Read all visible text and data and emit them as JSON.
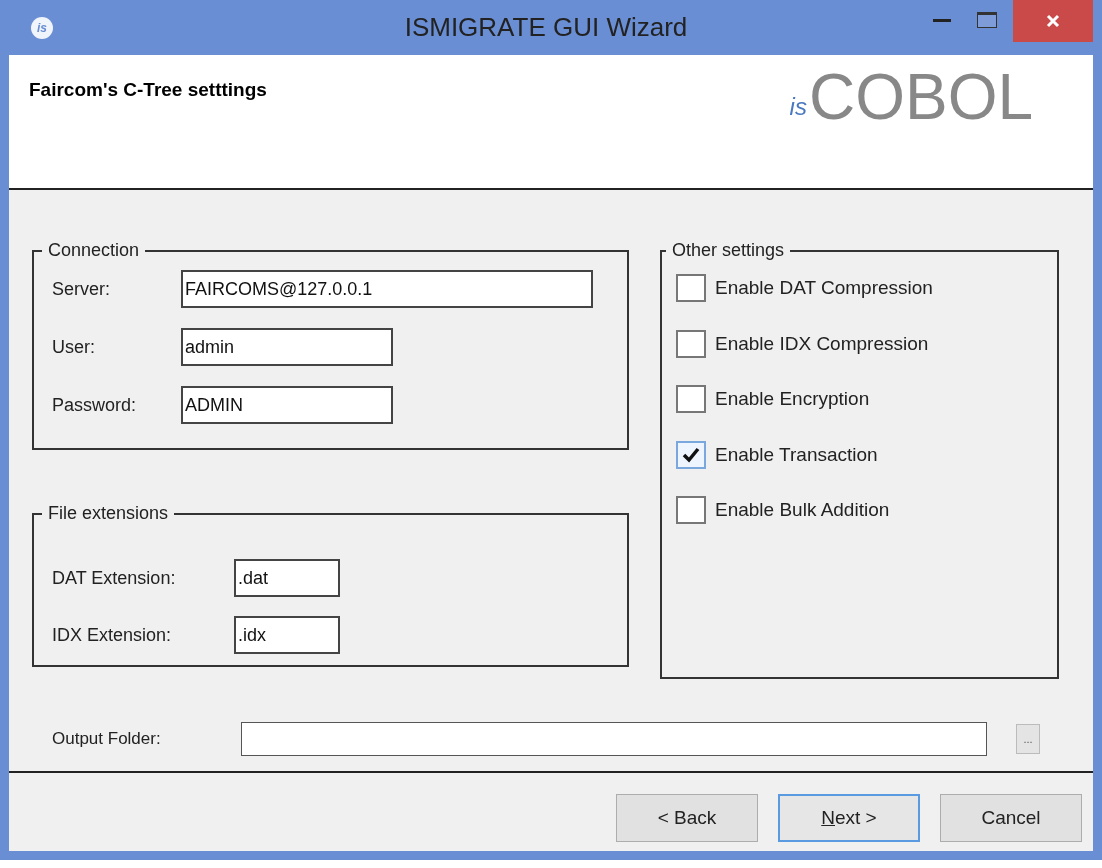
{
  "window": {
    "title": "ISMIGRATE GUI Wizard",
    "app_mark": "is"
  },
  "header": {
    "title": "Faircom's C-Tree setttings",
    "logo_mark": "is",
    "logo_text": "COBOL"
  },
  "connection": {
    "legend": "Connection",
    "fields": [
      {
        "label": "Server:",
        "value": "FAIRCOMS@127.0.0.1",
        "kind": "wide"
      },
      {
        "label": "User:",
        "value": "admin",
        "kind": "short"
      },
      {
        "label": "Password:",
        "value": "ADMIN",
        "kind": "short"
      }
    ]
  },
  "file_extensions": {
    "legend": "File extensions",
    "fields": [
      {
        "label": "DAT Extension:",
        "value": ".dat"
      },
      {
        "label": "IDX Extension:",
        "value": ".idx"
      }
    ]
  },
  "other_settings": {
    "legend": "Other settings",
    "options": [
      {
        "label": "Enable DAT Compression",
        "checked": false
      },
      {
        "label": "Enable IDX Compression",
        "checked": false
      },
      {
        "label": "Enable Encryption",
        "checked": false
      },
      {
        "label": "Enable Transaction",
        "checked": true
      },
      {
        "label": "Enable Bulk Addition",
        "checked": false
      }
    ]
  },
  "output_folder": {
    "label": "Output Folder:",
    "browse": "..."
  },
  "buttons": [
    {
      "label": "< Back",
      "default": false
    },
    {
      "label": "Next >",
      "default": true,
      "first_letter_underlined": true
    },
    {
      "label": "Cancel",
      "default": false
    }
  ]
}
